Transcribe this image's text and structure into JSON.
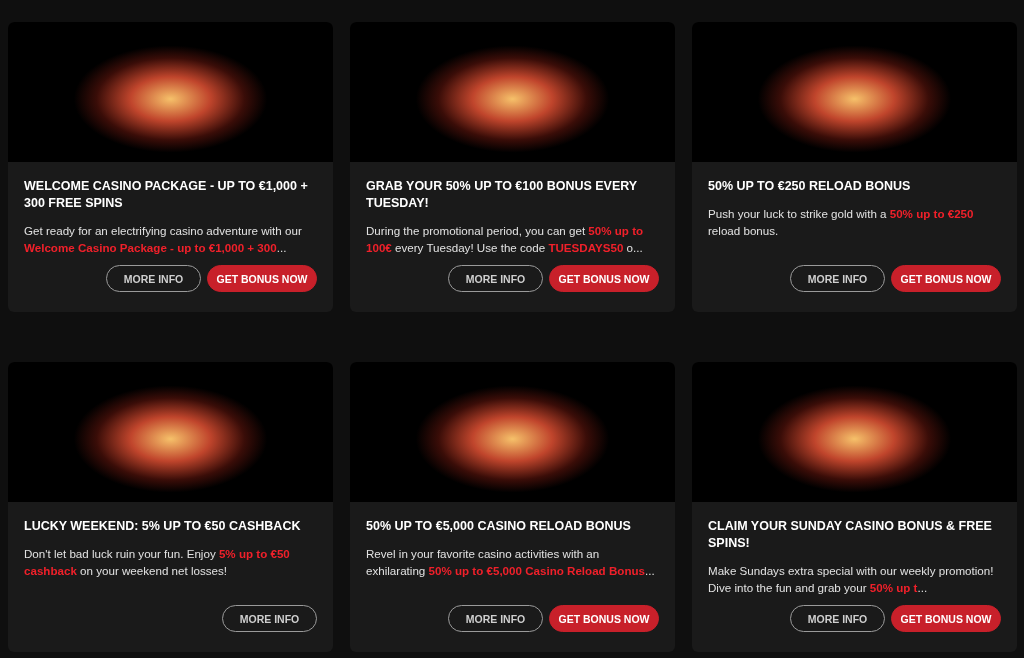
{
  "promotions": [
    {
      "title": "WELCOME CASINO PACKAGE - UP TO €1,000 + 300 FREE SPINS",
      "description": [
        {
          "text": "Get ready for an electrifying casino adventure with our ",
          "highlight": false
        },
        {
          "text": "Welcome Casino Package - up to €1,000 + 300",
          "highlight": true
        },
        {
          "text": "...",
          "highlight": false
        }
      ],
      "buttons": [
        {
          "label": "MORE INFO",
          "kind": "outline"
        },
        {
          "label": "GET BONUS NOW",
          "kind": "primary"
        }
      ]
    },
    {
      "title": "GRAB YOUR 50% UP TO €100 BONUS EVERY TUESDAY!",
      "description": [
        {
          "text": "During the promotional period, you can get ",
          "highlight": false
        },
        {
          "text": "50% up to 100€",
          "highlight": true
        },
        {
          "text": " every Tuesday! Use the code ",
          "highlight": false
        },
        {
          "text": "TUESDAYS50",
          "highlight": true
        },
        {
          "text": " o...",
          "highlight": false
        }
      ],
      "buttons": [
        {
          "label": "MORE INFO",
          "kind": "outline"
        },
        {
          "label": "GET BONUS NOW",
          "kind": "primary"
        }
      ]
    },
    {
      "title": "50% UP TO €250 RELOAD BONUS",
      "description": [
        {
          "text": "Push your luck to strike gold with a ",
          "highlight": false
        },
        {
          "text": "50% up to €250",
          "highlight": true
        },
        {
          "text": " reload bonus.",
          "highlight": false
        }
      ],
      "buttons": [
        {
          "label": "MORE INFO",
          "kind": "outline"
        },
        {
          "label": "GET BONUS NOW",
          "kind": "primary"
        }
      ]
    },
    {
      "title": "LUCKY WEEKEND: 5% UP TO €50 CASHBACK",
      "description": [
        {
          "text": "Don't let bad luck ruin your fun. Enjoy ",
          "highlight": false
        },
        {
          "text": "5% up to €50 cashback",
          "highlight": true
        },
        {
          "text": " on your weekend net losses!",
          "highlight": false
        }
      ],
      "buttons": [
        {
          "label": "MORE INFO",
          "kind": "outline"
        }
      ]
    },
    {
      "title": "50% UP TO €5,000 CASINO RELOAD BONUS",
      "description": [
        {
          "text": "Revel in your favorite casino activities with an exhilarating ",
          "highlight": false
        },
        {
          "text": "50% up to €5,000 Casino Reload Bonus",
          "highlight": true
        },
        {
          "text": "...",
          "highlight": false
        }
      ],
      "buttons": [
        {
          "label": "MORE INFO",
          "kind": "outline"
        },
        {
          "label": "GET BONUS NOW",
          "kind": "primary"
        }
      ]
    },
    {
      "title": "CLAIM YOUR SUNDAY CASINO BONUS & FREE SPINS!",
      "description": [
        {
          "text": "Make Sundays extra special with our weekly promotion! Dive into the fun and grab your ",
          "highlight": false
        },
        {
          "text": "50% up t",
          "highlight": true
        },
        {
          "text": "...",
          "highlight": false
        }
      ],
      "buttons": [
        {
          "label": "MORE INFO",
          "kind": "outline"
        },
        {
          "label": "GET BONUS NOW",
          "kind": "primary"
        }
      ]
    }
  ]
}
